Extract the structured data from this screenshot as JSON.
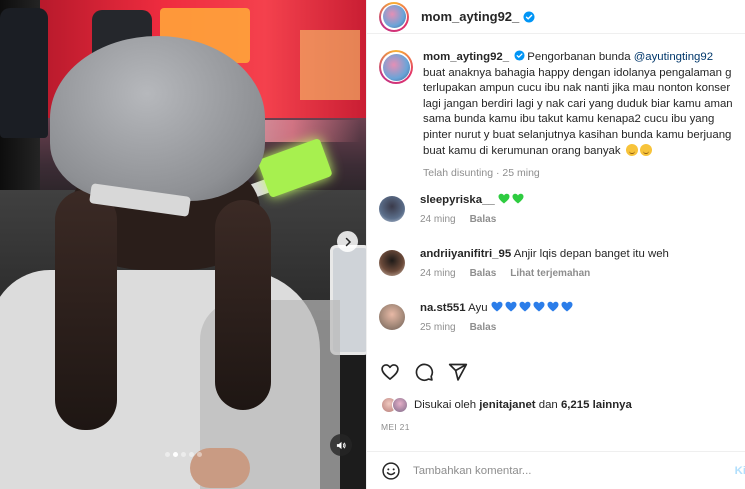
{
  "post": {
    "username": "mom_ayting92_",
    "verified": true,
    "caption_user": "mom_ayting92_",
    "caption_pre": "Pengorbanan bunda ",
    "caption_mention": "@ayutingting92",
    "caption_text": " buat anaknya bahagia happy dengan idolanya pengalaman g terlupakan ampun cucu ibu nak nanti jika mau nonton konser lagi jangan berdiri lagi y nak cari yang duduk biar kamu aman sama bunda kamu ibu takut kamu kenapa2 cucu ibu yang pinter nurut y buat selanjutnya kasihan bunda kamu berjuang buat kamu di kerumunan orang banyak",
    "edited_label": "Telah disunting",
    "caption_time": "25 ming"
  },
  "comments": [
    {
      "username": "sleepyriska__",
      "text": "",
      "hearts": 2,
      "heart_color": "green",
      "time": "24 ming",
      "reply_label": "Balas",
      "translate_label": ""
    },
    {
      "username": "andriiyanifitri_95",
      "text": "Anjir lqis depan banget itu weh",
      "hearts": 0,
      "heart_color": "",
      "time": "24 ming",
      "reply_label": "Balas",
      "translate_label": "Lihat terjemahan"
    },
    {
      "username": "na.st551",
      "text": "Ayu",
      "hearts": 6,
      "heart_color": "blue",
      "time": "25 ming",
      "reply_label": "Balas",
      "translate_label": ""
    }
  ],
  "likes": {
    "prefix": "Disukai oleh",
    "liker": "jenitajanet",
    "connector": "dan",
    "count_text": "6,215 lainnya"
  },
  "date": "MEI 21",
  "add_comment": {
    "placeholder": "Tambahkan komentar...",
    "post_label": "Ki"
  },
  "carousel": {
    "slide_count": 5,
    "active_index": 1
  },
  "colors": {
    "accent_link": "#00376b",
    "muted": "#8e8e8e",
    "verified_blue": "#0095f6",
    "green_heart": "#2ecc40",
    "blue_heart": "#2b7de9"
  },
  "icons": [
    "chevron-right-icon",
    "speaker-icon",
    "verified-icon",
    "heart-icon",
    "comment-icon",
    "share-icon",
    "emoji-icon"
  ]
}
